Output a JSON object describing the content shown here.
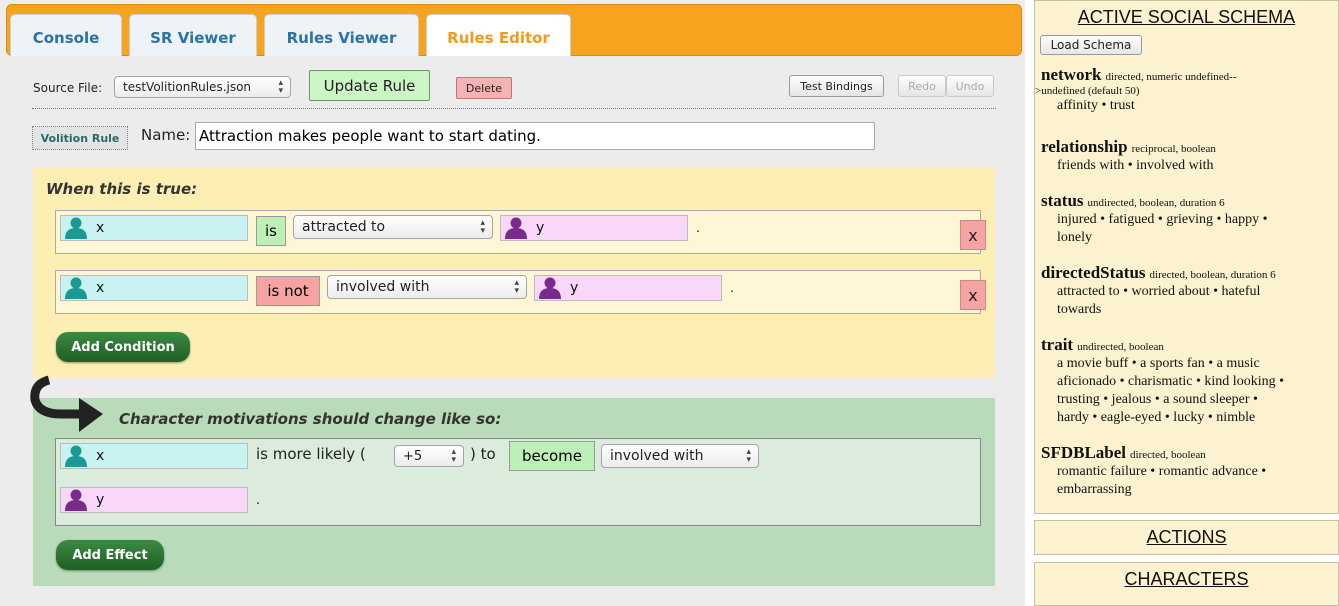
{
  "tabs": [
    {
      "label": "Console"
    },
    {
      "label": "SR Viewer"
    },
    {
      "label": "Rules Viewer"
    },
    {
      "label": "Rules Editor"
    }
  ],
  "toolbar": {
    "source_file_label": "Source File:",
    "source_file_value": "testVolitionRules.json",
    "update_rule": "Update Rule",
    "delete": "Delete",
    "test_bindings": "Test Bindings",
    "redo": "Redo",
    "undo": "Undo"
  },
  "rule": {
    "type_badge": "Volition Rule",
    "name_label": "Name:",
    "name_value": "Attraction makes people want to start dating."
  },
  "conditions": {
    "header": "When this is true:",
    "rows": [
      {
        "first": "x",
        "verb": "is",
        "predicate": "attracted to",
        "second": "y",
        "dot": ".",
        "remove": "x"
      },
      {
        "first": "x",
        "verb": "is not",
        "predicate": "involved with",
        "second": "y",
        "dot": ".",
        "remove": "x"
      }
    ],
    "add_label": "Add Condition"
  },
  "effects": {
    "header": "Character motivations should change like so:",
    "first": "x",
    "likely_prefix": "is more likely (",
    "weight": "+5",
    "likely_suffix": ") to",
    "verb": "become",
    "predicate": "involved with",
    "second": "y",
    "dot": ".",
    "add_label": "Add Effect"
  },
  "schema": {
    "title": "ACTIVE SOCIAL SCHEMA",
    "load_button": "Load Schema",
    "categories": [
      {
        "name": "network",
        "meta": "directed, numeric undefined--",
        "meta2": ">undefined (default 50)",
        "items": "affinity • trust"
      },
      {
        "name": "relationship",
        "meta": "reciprocal, boolean",
        "items": "friends with • involved with"
      },
      {
        "name": "status",
        "meta": "undirected, boolean, duration 6",
        "items": "injured • fatigued • grieving • happy •",
        "items2": "lonely"
      },
      {
        "name": "directedStatus",
        "meta": "directed, boolean, duration 6",
        "items": "attracted to • worried about • hateful",
        "items2": "towards"
      },
      {
        "name": "trait",
        "meta": "undirected, boolean",
        "items": "a movie buff • a sports fan • a music",
        "items2": "aficionado • charismatic • kind looking •",
        "items3": "trusting • jealous • a sound sleeper •",
        "items4": "hardy • eagle-eyed • lucky • nimble"
      },
      {
        "name": "SFDBLabel",
        "meta": "directed, boolean",
        "items": "romantic failure • romantic advance •",
        "items2": "embarrassing"
      }
    ]
  },
  "actions_title": "ACTIONS",
  "characters_title": "CHARACTERS",
  "colors": {
    "tabbar": "#f8a31d",
    "active_tab_text": "#f39a1a",
    "inactive_tab_text": "#2a73a6",
    "condition_bg": "#fdeeb3",
    "effect_bg": "#b9dbb9",
    "x_char": "#c9f3f3",
    "y_char": "#f9d7f9",
    "person_x": "#1a9a93",
    "person_y": "#7a2a8a"
  }
}
